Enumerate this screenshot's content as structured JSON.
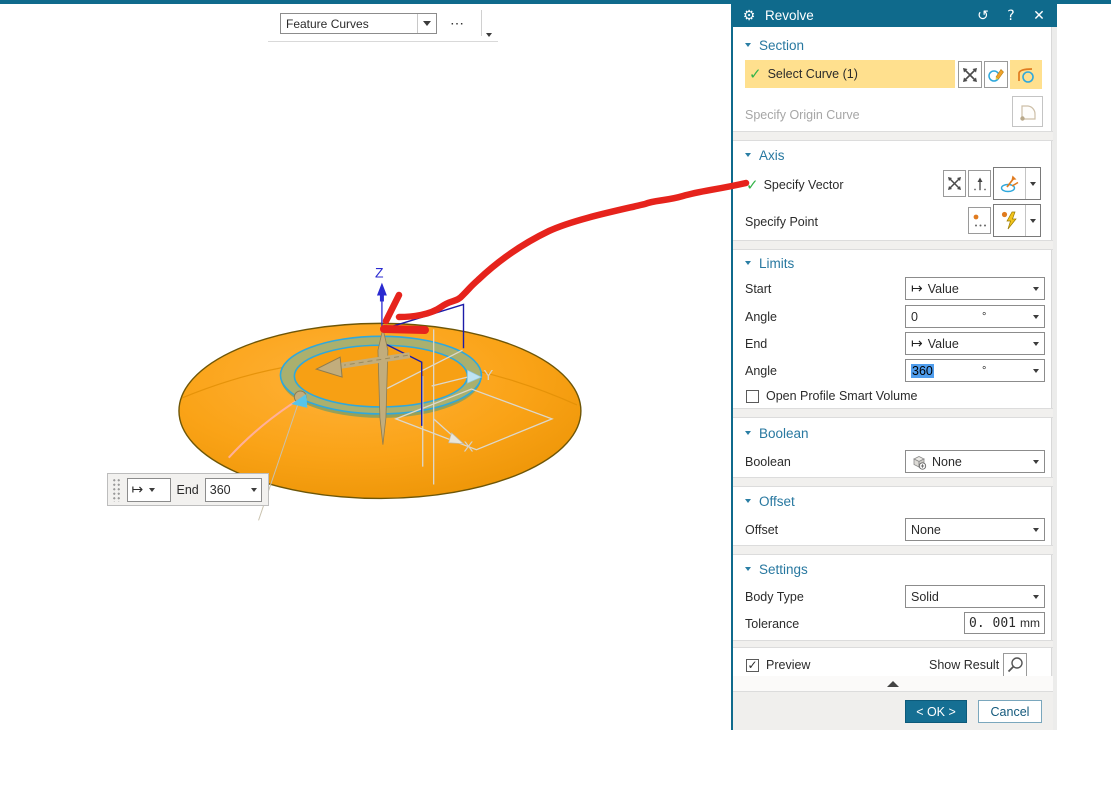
{
  "toolbar": {
    "feature_group_value": "Feature Curves",
    "more_label": "⋯"
  },
  "mini_toolbar": {
    "limit_symbol": "↦",
    "end_label": "End",
    "end_value": "360"
  },
  "viewport": {
    "x_label": "X",
    "y_label": "Y",
    "z_label": "Z"
  },
  "dialog": {
    "title": "Revolve",
    "section": {
      "title": "Section",
      "select_curve": "Select Curve (1)",
      "specify_origin_curve": "Specify Origin Curve"
    },
    "axis": {
      "title": "Axis",
      "specify_vector": "Specify Vector",
      "specify_point": "Specify Point"
    },
    "limits": {
      "title": "Limits",
      "start_label": "Start",
      "start_value": "Value",
      "start_angle_label": "Angle",
      "start_angle_value": "0",
      "end_label": "End",
      "end_value": "Value",
      "end_angle_label": "Angle",
      "end_angle_value": "360",
      "degree_symbol": "°",
      "open_profile_label": "Open Profile Smart Volume"
    },
    "boolean": {
      "title": "Boolean",
      "label": "Boolean",
      "value": "None"
    },
    "offset": {
      "title": "Offset",
      "label": "Offset",
      "value": "None"
    },
    "settings": {
      "title": "Settings",
      "body_type_label": "Body Type",
      "body_type_value": "Solid",
      "tolerance_label": "Tolerance",
      "tolerance_value": "0. 001",
      "tolerance_unit": "mm"
    },
    "footer": {
      "preview_label": "Preview",
      "show_result_label": "Show Result",
      "ok_label": "< OK >",
      "cancel_label": "Cancel"
    }
  },
  "icons": {
    "gear": "⚙",
    "reset": "↺",
    "help": "?",
    "close": "✕",
    "check": "✓",
    "limit_value": "↦",
    "names": [
      "gear-icon",
      "reset-icon",
      "help-icon",
      "close-icon",
      "deselect-icon",
      "sketch-section-icon",
      "curve-icon",
      "origin-curve-icon",
      "inferred-vector-icon",
      "vector-dialog-icon",
      "point-dialog-icon",
      "autojudge-point-icon",
      "boolean-none-cube-icon",
      "magnifier-icon",
      "dropdown-caret-icon",
      "collapse-arrow-icon",
      "grip-handle"
    ]
  },
  "colors": {
    "header_teal": "#0f6a8c",
    "group_title_blue": "#2878a0",
    "highlight_yellow": "#ffe08e",
    "selection_blue": "#4f9ded",
    "annotation_red": "#e6231c",
    "disc_orange": "#f9a117",
    "ring_khaki": "#aab06e",
    "ring_outline_cyan": "#2fa8dc"
  }
}
